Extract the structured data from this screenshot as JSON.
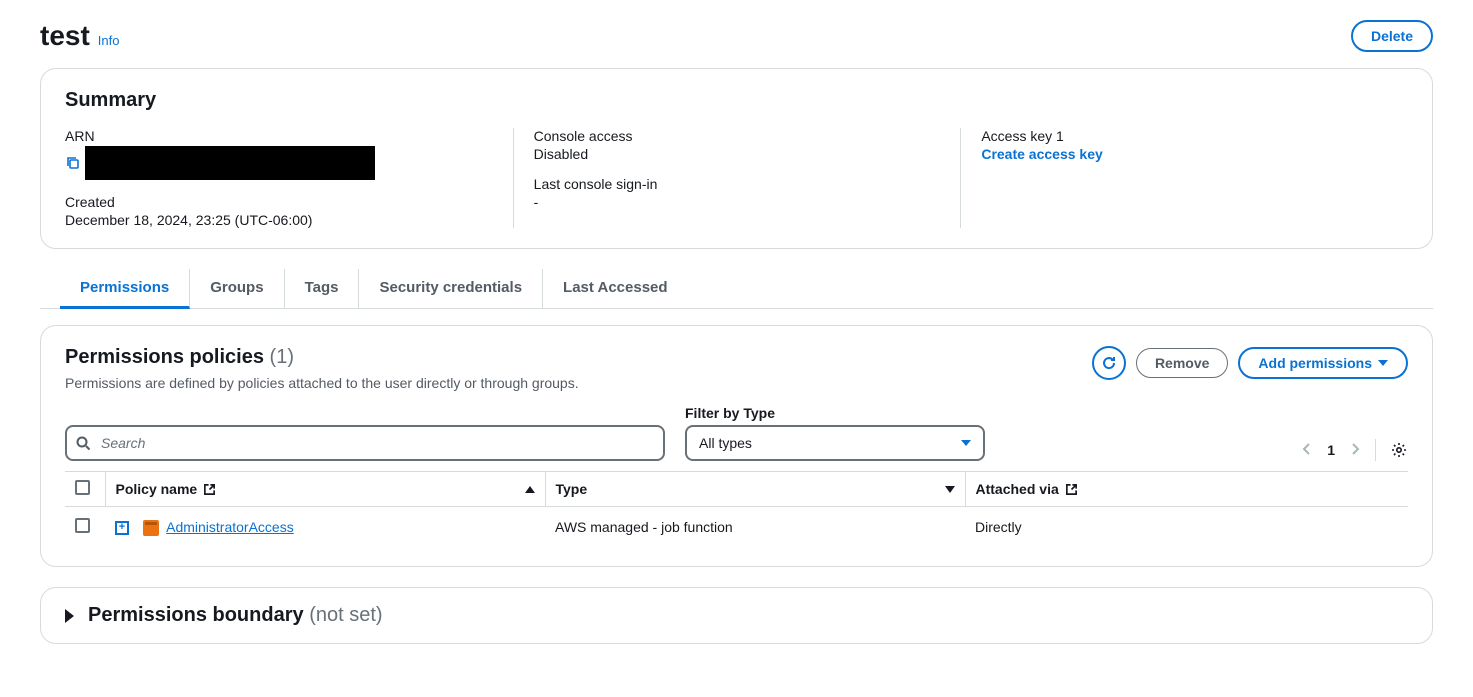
{
  "header": {
    "title": "test",
    "info": "Info",
    "delete_btn": "Delete"
  },
  "summary": {
    "heading": "Summary",
    "arn_label": "ARN",
    "created_label": "Created",
    "created_value": "December 18, 2024, 23:25 (UTC-06:00)",
    "console_access_label": "Console access",
    "console_access_value": "Disabled",
    "last_signin_label": "Last console sign-in",
    "last_signin_value": "-",
    "access_key_label": "Access key 1",
    "create_access_key": "Create access key"
  },
  "tabs": [
    "Permissions",
    "Groups",
    "Tags",
    "Security credentials",
    "Last Accessed"
  ],
  "policies": {
    "heading": "Permissions policies",
    "count": "(1)",
    "desc": "Permissions are defined by policies attached to the user directly or through groups.",
    "remove_btn": "Remove",
    "add_btn": "Add permissions",
    "search_placeholder": "Search",
    "filter_label": "Filter by Type",
    "filter_value": "All types",
    "page": "1",
    "cols": {
      "name": "Policy name",
      "type": "Type",
      "attached": "Attached via"
    },
    "rows": [
      {
        "name": "AdministratorAccess",
        "type": "AWS managed - job function",
        "attached": "Directly"
      }
    ]
  },
  "boundary": {
    "title": "Permissions boundary",
    "status": "(not set)"
  }
}
